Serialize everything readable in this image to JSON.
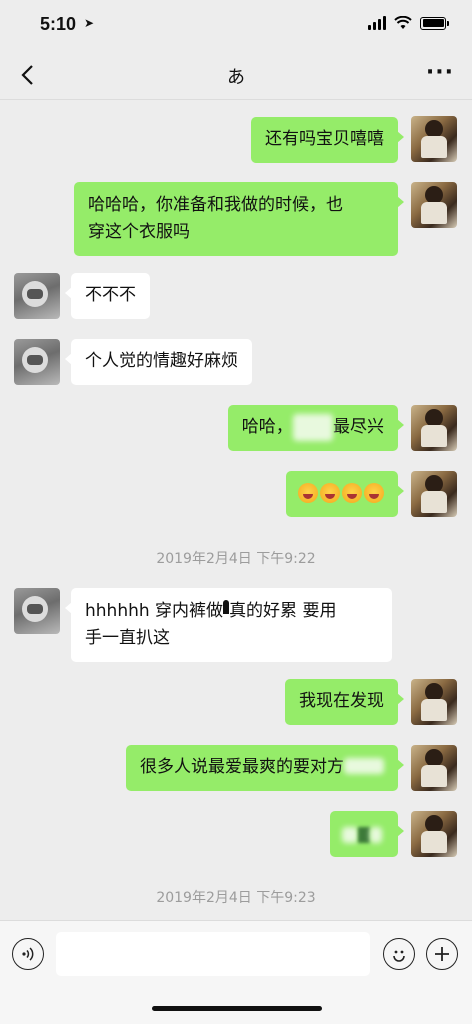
{
  "status": {
    "time": "5:10"
  },
  "nav": {
    "title": "あ"
  },
  "messages": [
    {
      "from": "me",
      "text": "还有吗宝贝嘻嘻"
    },
    {
      "from": "me",
      "text_line1": "哈哈哈，你准备和我做的时候，也",
      "text_line2": "穿这个衣服吗"
    },
    {
      "from": "them",
      "text": "不不不"
    },
    {
      "from": "them",
      "text": "个人觉的情趣好麻烦"
    },
    {
      "from": "me",
      "text_pre": "哈哈，",
      "text_hidden": "xxxx",
      "text_post": "最尽兴"
    },
    {
      "from": "me",
      "emoji_count": 4
    },
    {
      "from": "them",
      "text_line1_pre": "hhhhhh 穿内裤做",
      "text_line1_post": "真的好累 要用",
      "text_line2": "手一直扒这"
    },
    {
      "from": "me",
      "text": "我现在发现"
    },
    {
      "from": "me",
      "text": "很多人说最爱最爽的要对方"
    },
    {
      "from": "me",
      "text": ""
    }
  ],
  "timestamps": {
    "t1": "2019年2月4日 下午9:22",
    "t2": "2019年2月4日 下午9:23"
  },
  "colors": {
    "bubble_me": "#95ec69",
    "bubble_them": "#ffffff",
    "background": "#ededed"
  },
  "icons": {
    "back": "chevron-left-icon",
    "more": "more-dots-icon",
    "voice": "voice-icon",
    "emoji": "emoji-icon",
    "plus": "plus-icon"
  }
}
